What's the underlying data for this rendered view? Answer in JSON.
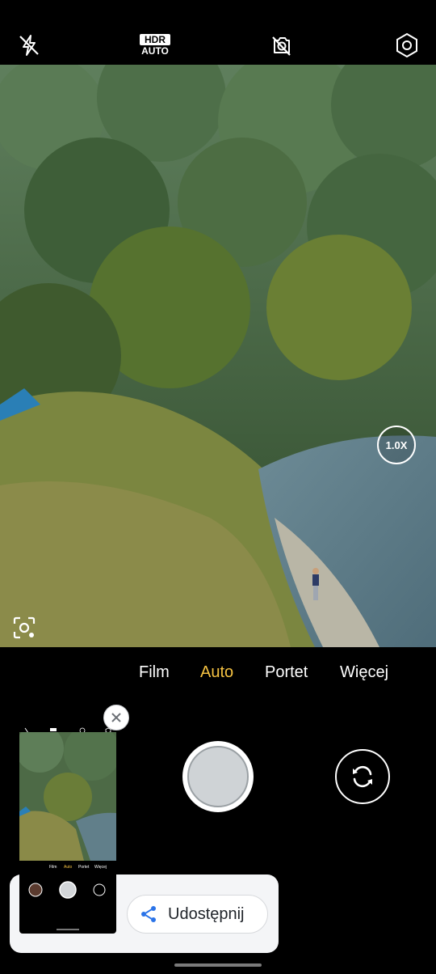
{
  "top_bar": {
    "flash_icon": "flash-off-icon",
    "hdr": {
      "top": "HDR",
      "bottom": "AUTO"
    },
    "motion_icon": "motion-off-icon",
    "settings_icon": "settings-icon"
  },
  "viewfinder": {
    "zoom_label": "1.0X",
    "lens_icon": "scan-lens-icon"
  },
  "modes": [
    {
      "label": "Film",
      "active": false
    },
    {
      "label": "Auto",
      "active": true
    },
    {
      "label": "Portet",
      "active": false
    },
    {
      "label": "Więcej",
      "active": false
    }
  ],
  "controls": {
    "shutter": "shutter-button",
    "switch_camera_icon": "camera-switch-icon"
  },
  "screenshot_preview": {
    "share_label": "Udostępnij",
    "share_icon": "share-icon",
    "close_icon": "close-icon",
    "thumb_modes": [
      "Film",
      "Auto",
      "Portet",
      "Więcej"
    ]
  },
  "colors": {
    "accent": "#f5c242",
    "share_icon": "#2a73e8"
  }
}
